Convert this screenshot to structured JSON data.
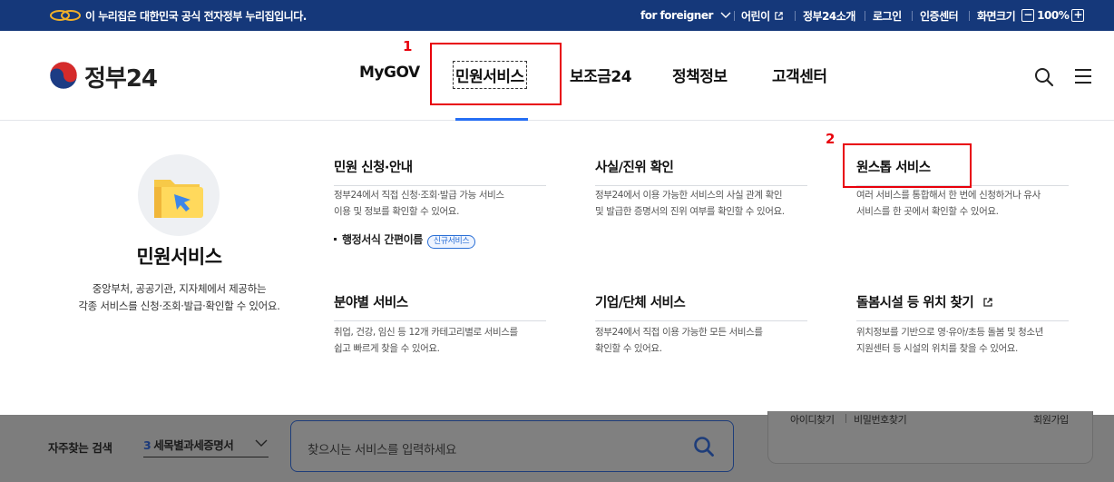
{
  "banner": {
    "notice": "이 누리집은 대한민국 공식 전자정부 누리집입니다.",
    "foreigner": "for foreigner",
    "kids": "어린이",
    "gov_intro": "정부24소개",
    "login": "로그인",
    "cert_center": "인증센터",
    "screen_size_label": "화면크기",
    "zoom_level": "100%",
    "zoom_out": "−",
    "zoom_in": "+"
  },
  "header": {
    "logo_text": "정부24",
    "nav": [
      "MyGOV",
      "민원서비스",
      "보조금24",
      "정책정보",
      "고객센터"
    ],
    "active_nav": "민원서비스"
  },
  "annotations": {
    "first": "1",
    "second": "2"
  },
  "mega_menu": {
    "intro": {
      "title": "민원서비스",
      "desc_line1": "중앙부처, 공공기관, 지자체에서 제공하는",
      "desc_line2": "각종 서비스를 신청·조회·발급·확인할 수 있어요."
    },
    "items": [
      {
        "title": "민원 신청·안내",
        "desc_line1": "정부24에서 직접 신청·조회·발급 가능 서비스",
        "desc_line2": "이용 및 정보를 확인할 수 있어요.",
        "sub_link": "행정서식 간편이름",
        "badge": "신규서비스"
      },
      {
        "title": "사실/진위 확인",
        "desc_line1": "정부24에서 이용 가능한 서비스의 사실 관계 확인",
        "desc_line2": "및 발급한 증명서의 진위 여부를 확인할 수 있어요."
      },
      {
        "title": "원스톱 서비스",
        "desc_line1": "여러 서비스를 통합해서 한 번에 신청하거나 유사",
        "desc_line2": "서비스를 한 곳에서 확인할 수 있어요."
      },
      {
        "title": "분야별 서비스",
        "desc_line1": "취업, 건강, 임신 등 12개 카테고리별로 서비스를",
        "desc_line2": "쉽고 빠르게 찾을 수 있어요."
      },
      {
        "title": "기업/단체 서비스",
        "desc_line1": "정부24에서 직접 이용 가능한 모든 서비스를",
        "desc_line2": "확인할 수 있어요."
      },
      {
        "title": "돌봄시설 등 위치 찾기",
        "desc_line1": "위치정보를 기반으로 영·유아/초등 돌봄 및 청소년",
        "desc_line2": "지원센터 등 시설의 위치를 찾을 수 있어요."
      }
    ]
  },
  "background_page": {
    "frequent_label": "자주찾는 검색",
    "frequent_rank": "3",
    "frequent_value": "세목별과세증명서",
    "search_placeholder": "찾으시는 서비스를 입력하세요",
    "find_id": "아이디찾기",
    "find_pw": "비밀번호찾기",
    "signup": "회원가입"
  },
  "colors": {
    "banner_bg": "#15387a",
    "accent_blue": "#256ef4",
    "annotation_red": "#e8000b",
    "dim_overlay": "#7d7d7d"
  }
}
